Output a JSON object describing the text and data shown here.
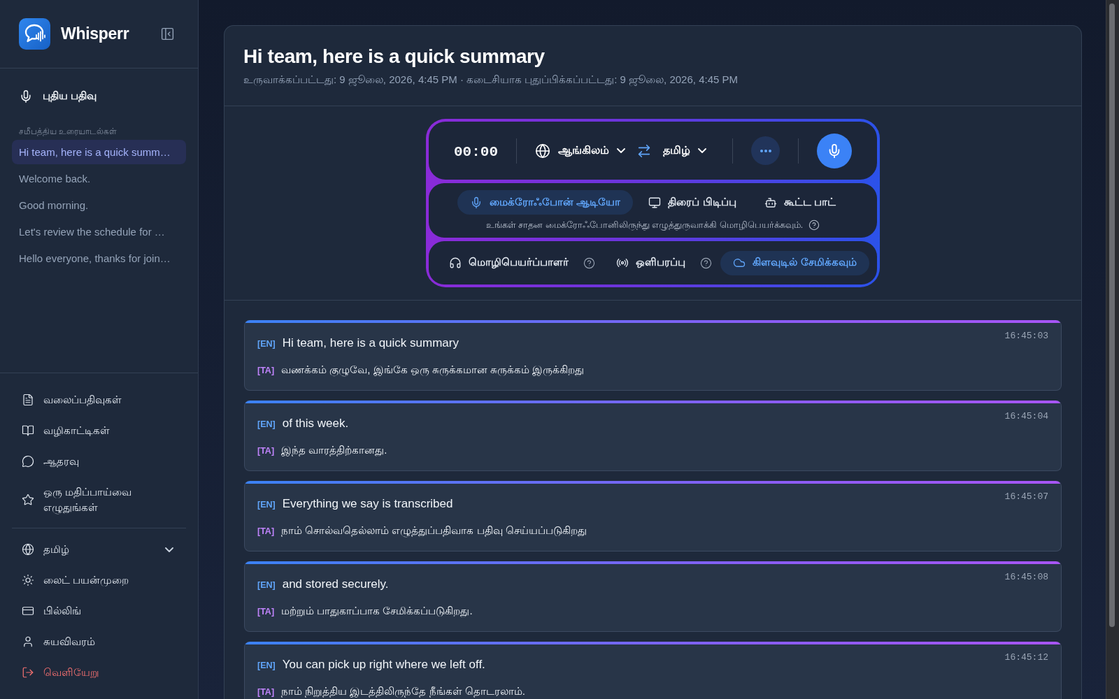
{
  "sidebar": {
    "brand": "Whisperr",
    "new_recording": "புதிய பதிவு",
    "recent_heading": "சமீபத்திய உரையாடல்கள்",
    "conversations": [
      {
        "title": "Hi team, here is a quick summ…",
        "selected": true
      },
      {
        "title": "Welcome back.",
        "selected": false
      },
      {
        "title": "Good morning.",
        "selected": false
      },
      {
        "title": "Let's review the schedule for …",
        "selected": false
      },
      {
        "title": "Hello everyone, thanks for join…",
        "selected": false
      }
    ],
    "resources": [
      {
        "label": "வலைப்பதிவுகள்"
      },
      {
        "label": "வழிகாட்டிகள்"
      },
      {
        "label": "ஆதரவு"
      },
      {
        "label": "ஒரு மதிப்பாய்வை எழுதுங்கள்"
      }
    ],
    "settings": [
      {
        "kind": "dropdown",
        "label": "தமிழ்"
      },
      {
        "kind": "link",
        "label": "லைட் பயன்முறை"
      },
      {
        "kind": "link",
        "label": "பில்லிங்"
      },
      {
        "kind": "link",
        "label": "சுயவிவரம்"
      },
      {
        "kind": "danger",
        "label": "வெளியேறு"
      }
    ]
  },
  "conversation": {
    "title": "Hi team, here is a quick summary",
    "meta": "உருவாக்கப்பட்டது: 9 ஜூலை, 2026, 4:45 PM · கடைசியாக புதுப்பிக்கப்பட்டது: 9 ஜூலை, 2026, 4:45 PM"
  },
  "recorder": {
    "timer": "00:00",
    "source_language": "ஆங்கிலம்",
    "target_language": "தமிழ்",
    "input_modes": [
      {
        "label": "மைக்ரோஃபோன் ஆடியோ",
        "selected": true
      },
      {
        "label": "திரைப் பிடிப்பு",
        "selected": false
      },
      {
        "label": "கூட்ட பாட்",
        "selected": false
      }
    ],
    "mode_hint": "உங்கள் சாதன மைக்ரோஃபோனிலிருந்து எழுத்துருவாக்கி மொழிபெயர்க்கவும்.",
    "options": [
      {
        "label": "மொழிபெயர்ப்பாளர்",
        "on": false,
        "help": true
      },
      {
        "label": "ஒளிபரப்பு",
        "on": false,
        "help": true
      },
      {
        "label": "கிளவுடில் சேமிக்கவும்",
        "on": true,
        "help": false
      }
    ]
  },
  "transcript": [
    {
      "time": "16:45:03",
      "lines": [
        {
          "kind": "source",
          "tag": "[EN]",
          "text": "Hi team, here is a quick summary"
        },
        {
          "kind": "translation",
          "tag": "[TA]",
          "text": "வணக்கம் குழுவே, இங்கே ஒரு சுருக்கமான சுருக்கம் இருக்கிறது"
        }
      ]
    },
    {
      "time": "16:45:04",
      "lines": [
        {
          "kind": "source",
          "tag": "[EN]",
          "text": "of this week."
        },
        {
          "kind": "translation",
          "tag": "[TA]",
          "text": "இந்த வாரத்திற்கானது."
        }
      ]
    },
    {
      "time": "16:45:07",
      "lines": [
        {
          "kind": "source",
          "tag": "[EN]",
          "text": "Everything we say is transcribed"
        },
        {
          "kind": "translation",
          "tag": "[TA]",
          "text": "நாம் சொல்வதெல்லாம் எழுத்துப்பதிவாக பதிவு செய்யப்படுகிறது"
        }
      ]
    },
    {
      "time": "16:45:08",
      "lines": [
        {
          "kind": "source",
          "tag": "[EN]",
          "text": "and stored securely."
        },
        {
          "kind": "translation",
          "tag": "[TA]",
          "text": "மற்றும் பாதுகாப்பாக சேமிக்கப்படுகிறது."
        }
      ]
    },
    {
      "time": "16:45:12",
      "lines": [
        {
          "kind": "source",
          "tag": "[EN]",
          "text": "You can pick up right where we left off."
        },
        {
          "kind": "translation",
          "tag": "[TA]",
          "text": "நாம் நிறுத்திய இடத்திலிருந்தே நீங்கள் தொடரலாம்."
        }
      ]
    }
  ]
}
